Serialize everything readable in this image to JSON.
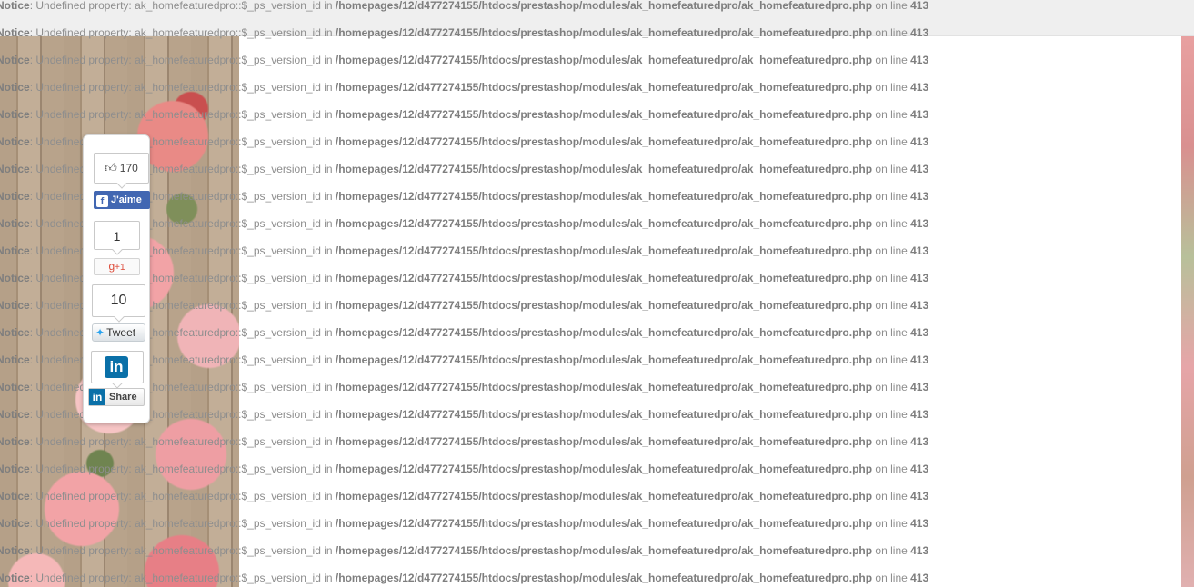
{
  "notice": {
    "label": "Notice",
    "message": ": Undefined property: ak_homefeaturedpro::$_ps_version_id in ",
    "path": "/homepages/12/d477274155/htdocs/prestashop/modules/ak_homefeaturedpro/ak_homefeaturedpro.php",
    "on_line": " on line ",
    "line": "413",
    "repeat_count": 22
  },
  "share": {
    "facebook": {
      "count": "170",
      "button_label": "J'aime",
      "icon": "facebook-icon"
    },
    "google": {
      "count": "1",
      "button_label": "g",
      "plus_label": "+1",
      "icon": "google-plus-icon"
    },
    "twitter": {
      "count": "10",
      "button_label": "Tweet",
      "icon": "twitter-bird-icon"
    },
    "linkedin": {
      "logo_label": "in",
      "button_label": "Share",
      "icon": "linkedin-icon"
    }
  },
  "colors": {
    "facebook": "#4267b2",
    "google": "#dd4b39",
    "twitter": "#2aa3ef",
    "linkedin": "#0a70a8"
  }
}
